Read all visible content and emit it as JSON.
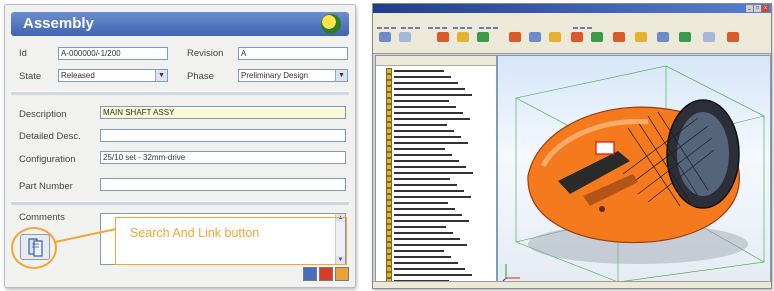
{
  "assembly": {
    "title": "Assembly",
    "fields": {
      "id": {
        "label": "Id",
        "value": "A-000000/-1/200"
      },
      "revision": {
        "label": "Revision",
        "value": "A"
      },
      "state": {
        "label": "State",
        "value": "Released"
      },
      "phase": {
        "label": "Phase",
        "value": "Preliminary Design"
      },
      "description": {
        "label": "Description",
        "value": "MAIN SHAFT ASSY"
      },
      "detailed_desc": {
        "label": "Detailed Desc.",
        "value": ""
      },
      "configuration": {
        "label": "Configuration",
        "value": "25/10 set - 32mm-drive"
      },
      "part_number": {
        "label": "Part Number",
        "value": ""
      },
      "comments": {
        "label": "Comments",
        "value": ""
      }
    }
  },
  "callout": {
    "text": "Search And Link button"
  },
  "cad_window": {
    "tree_rows": 36
  },
  "colors": {
    "accent": "#f2a636",
    "header_blue": "#4a6cbf",
    "model_orange": "#f57a1e"
  },
  "icons": [
    "logo-icon",
    "search-and-link-icon",
    "help-icon",
    "stop-icon",
    "info-icon",
    "close-icon",
    "minimize-icon",
    "maximize-icon"
  ]
}
